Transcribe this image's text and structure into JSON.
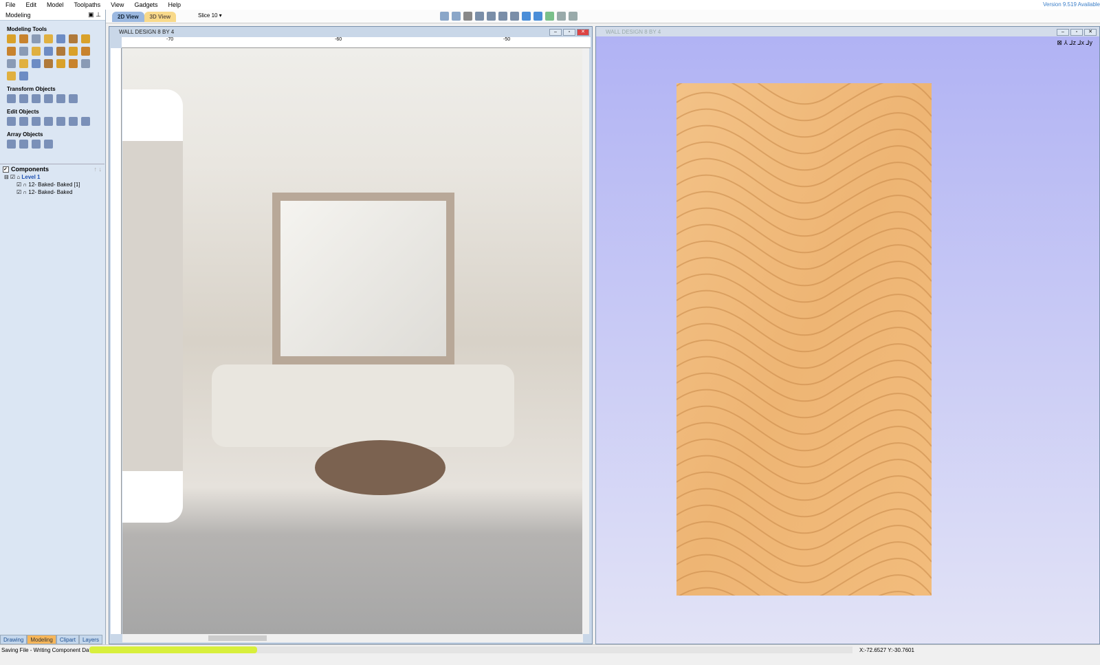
{
  "menu": [
    "File",
    "Edit",
    "Model",
    "Toolpaths",
    "View",
    "Gadgets",
    "Help"
  ],
  "version_notice": "Version 9.519 Available",
  "panel": {
    "title": "Modeling",
    "sections": [
      "Modeling Tools",
      "Transform Objects",
      "Edit Objects",
      "Array Objects"
    ],
    "components_label": "Components",
    "tree": [
      {
        "label": "Level 1"
      },
      {
        "label": "12- Baked- Baked [1]"
      },
      {
        "label": "12- Baked- Baked"
      }
    ]
  },
  "bottom_tabs": [
    "Drawing",
    "Modeling",
    "Clipart",
    "Layers"
  ],
  "view_tabs": [
    "2D View",
    "3D View"
  ],
  "slice": "Slice 10 ▾",
  "view2d": {
    "title": "WALL DESIGN 8 BY 4",
    "ruler": [
      "-70",
      "-60",
      "-50"
    ]
  },
  "view3d": {
    "title": "WALL DESIGN 8 BY 4"
  },
  "status": {
    "message": "Saving File - Writing Component Data",
    "progress": 0.22,
    "coords": "X:-72.6527 Y:-30.7601"
  },
  "colors": {
    "accent": "#3c7fc8",
    "panel": "#dbe6f3",
    "view3d_bg": "#b4b6f4",
    "wood": "#f0b777",
    "progress": "#d8ef3c"
  }
}
